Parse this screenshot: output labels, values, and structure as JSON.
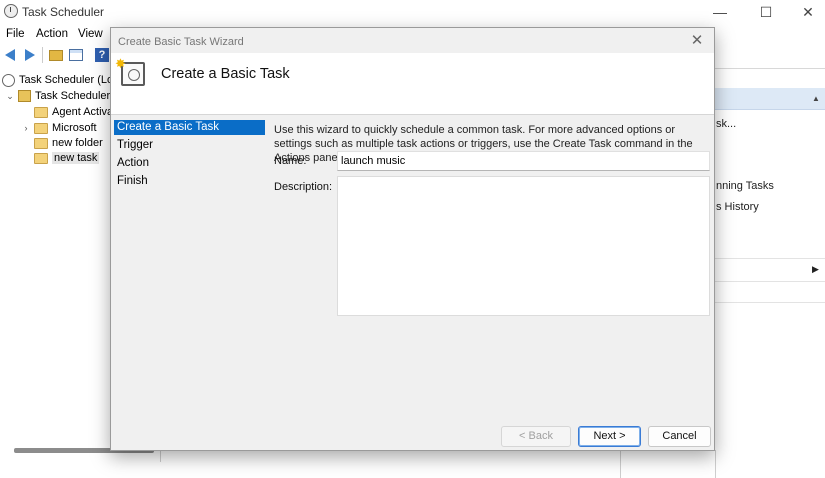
{
  "app": {
    "title": "Task Scheduler"
  },
  "window_controls": {
    "minimize": "—",
    "maximize": "☐",
    "close": "✕"
  },
  "menu": [
    "File",
    "Action",
    "View"
  ],
  "tree": {
    "root": "Task Scheduler (Loca",
    "library": "Task Scheduler L",
    "items": [
      "Agent Activa",
      "Microsoft",
      "new folder",
      "new task"
    ]
  },
  "bg_actions": {
    "lines": [
      "sk...",
      "nning Tasks",
      "s History"
    ]
  },
  "dialog": {
    "title": "Create Basic Task Wizard",
    "close": "✕",
    "header_title": "Create a Basic Task",
    "steps": [
      "Create a Basic Task",
      "Trigger",
      "Action",
      "Finish"
    ],
    "description": "Use this wizard to quickly schedule a common task.  For more advanced options or settings such as multiple task actions or triggers, use the Create Task command in the Actions pane.",
    "name_label": "Name:",
    "name_value": "launch music",
    "description_label": "Description:",
    "description_value": "",
    "buttons": {
      "back": "< Back",
      "next": "Next >",
      "cancel": "Cancel"
    }
  }
}
